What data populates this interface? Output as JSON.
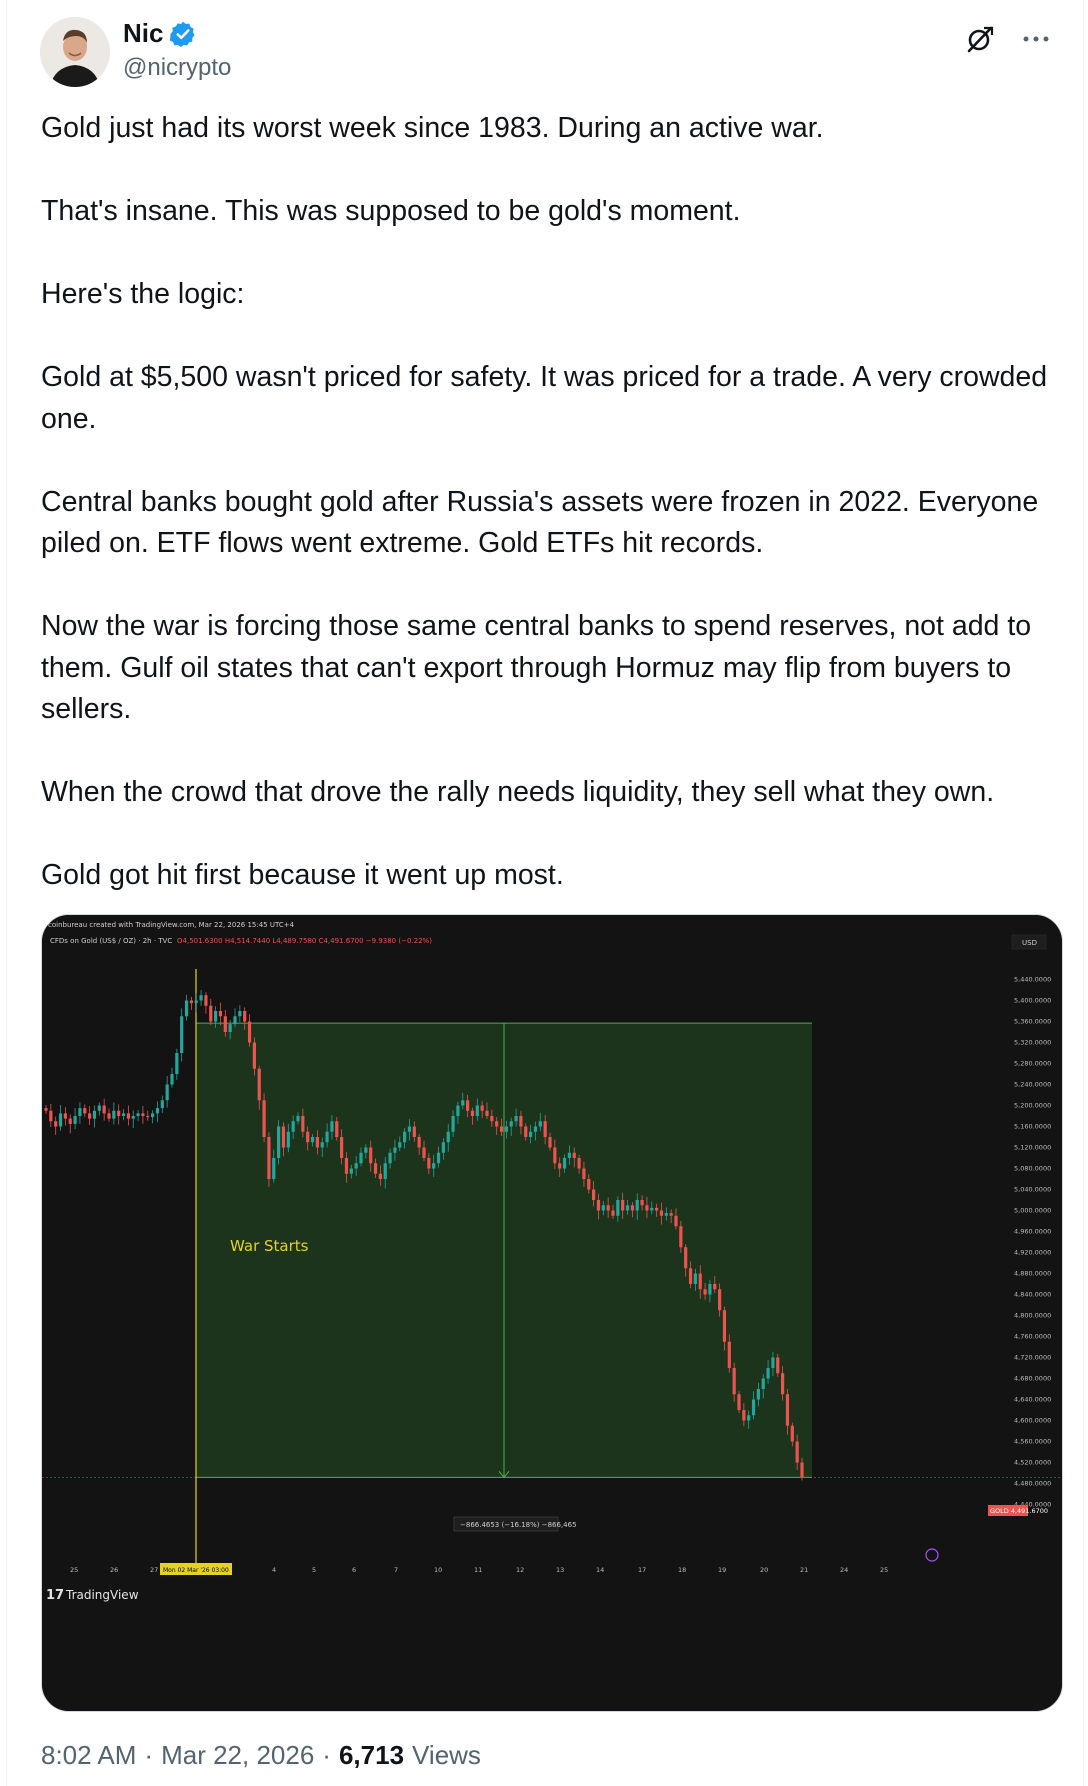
{
  "author": {
    "name": "Nic",
    "handle": "@nicrypto",
    "verified": true
  },
  "icons": {
    "grok": "grok-icon",
    "more": "more-icon",
    "verified": "verified-badge-icon"
  },
  "tweet": {
    "paragraphs": [
      "Gold just had its worst week since 1983. During an active war.",
      "That's insane. This was supposed to be gold's moment.",
      "Here's the logic:",
      "Gold at $5,500 wasn't priced for safety. It was priced for a trade. A very crowded one.",
      "Central banks bought gold after Russia's assets were frozen in 2022. Everyone piled on. ETF flows went extreme. Gold ETFs hit records.",
      "Now the war is forcing those same central banks to spend reserves, not add to them. Gulf oil states that can't export through Hormuz may flip from buyers to sellers.",
      "When the crowd that drove the rally needs liquidity, they sell what they own.",
      "Gold got hit first because it went up most."
    ]
  },
  "footer": {
    "time": "8:02 AM",
    "separator": "·",
    "date": "Mar 22, 2026",
    "views_count": "6,713",
    "views_label": "Views"
  },
  "colors": {
    "up_candle": "#26a69a",
    "down_candle": "#ef5350",
    "measure_box": "#1e3a1e",
    "measure_line": "#4caf50",
    "war_line": "#e6d31f",
    "chart_bg": "#131313"
  },
  "chart_data": {
    "type": "candlestick",
    "header_credit": "coinbureau created with TradingView.com, Mar 22, 2026 15:45 UTC+4",
    "symbol_line": "CFDs on Gold (US$ / OZ) · 2h · TVC",
    "ohlc_line": "O4,501.6300 H4,514.7440 L4,489.7580 C4,491.6700 −9.9380 (−0.22%)",
    "currency": "USD",
    "annotation": "War Starts",
    "measure_label": "−866.4653 (−16.18%) −866,465",
    "last_price_label": "GOLD 4,491.6700",
    "date_marker": "Mon 02 Mar '26 03:00",
    "watermark": "TradingView",
    "ylim": [
      4420,
      5460
    ],
    "y_ticks": [
      "5,440.0000",
      "5,400.0000",
      "5,360.0000",
      "5,320.0000",
      "5,280.0000",
      "5,240.0000",
      "5,200.0000",
      "5,160.0000",
      "5,120.0000",
      "5,080.0000",
      "5,040.0000",
      "5,000.0000",
      "4,960.0000",
      "4,920.0000",
      "4,880.0000",
      "4,840.0000",
      "4,800.0000",
      "4,760.0000",
      "4,720.0000",
      "4,680.0000",
      "4,640.0000",
      "4,600.0000",
      "4,560.0000",
      "4,520.0000",
      "4,480.0000",
      "4,440.0000"
    ],
    "x_ticks": [
      "25",
      "26",
      "27",
      "Mon 02 Mar '26 03:00",
      "4",
      "5",
      "6",
      "7",
      "10",
      "11",
      "12",
      "13",
      "14",
      "17",
      "18",
      "19",
      "20",
      "21",
      "24",
      "25"
    ],
    "closes": [
      5190,
      5170,
      5160,
      5185,
      5175,
      5165,
      5180,
      5195,
      5185,
      5175,
      5190,
      5200,
      5185,
      5175,
      5190,
      5180,
      5185,
      5175,
      5180,
      5185,
      5180,
      5178,
      5185,
      5195,
      5210,
      5240,
      5260,
      5300,
      5370,
      5400,
      5395,
      5400,
      5410,
      5390,
      5360,
      5380,
      5370,
      5340,
      5355,
      5370,
      5380,
      5360,
      5320,
      5270,
      5210,
      5140,
      5060,
      5100,
      5160,
      5120,
      5150,
      5170,
      5180,
      5150,
      5130,
      5140,
      5120,
      5130,
      5150,
      5170,
      5140,
      5100,
      5070,
      5080,
      5090,
      5110,
      5120,
      5090,
      5070,
      5060,
      5090,
      5110,
      5120,
      5130,
      5150,
      5160,
      5140,
      5120,
      5100,
      5080,
      5090,
      5110,
      5130,
      5150,
      5180,
      5200,
      5210,
      5190,
      5180,
      5200,
      5190,
      5180,
      5170,
      5160,
      5150,
      5160,
      5170,
      5180,
      5160,
      5140,
      5150,
      5160,
      5170,
      5140,
      5120,
      5090,
      5080,
      5100,
      5110,
      5100,
      5080,
      5060,
      5040,
      5020,
      5000,
      5010,
      5000,
      4990,
      5020,
      5000,
      5010,
      5000,
      5020,
      5010,
      5000,
      5005,
      5000,
      4990,
      4995,
      4990,
      4970,
      4930,
      4890,
      4860,
      4880,
      4850,
      4840,
      4860,
      4850,
      4810,
      4750,
      4700,
      4650,
      4620,
      4600,
      4610,
      4640,
      4660,
      4680,
      4700,
      4720,
      4690,
      4650,
      4590,
      4560,
      4520,
      4491.67
    ]
  }
}
